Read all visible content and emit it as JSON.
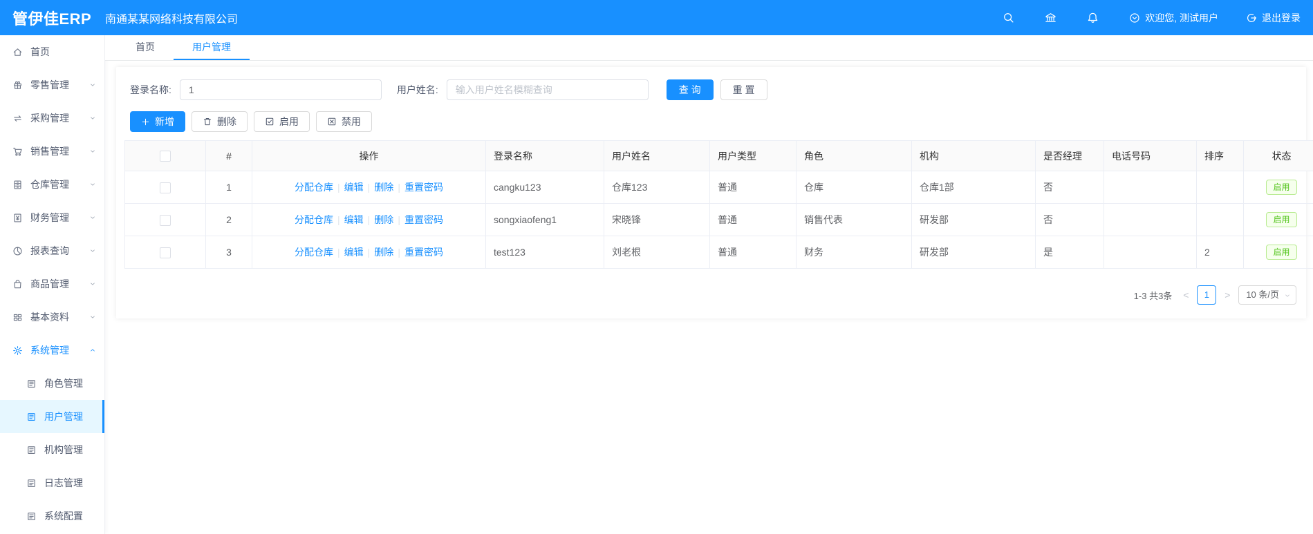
{
  "header": {
    "logo": "管伊佳ERP",
    "company": "南通某某网络科技有限公司",
    "welcome": "欢迎您, 测试用户",
    "logout": "退出登录"
  },
  "sidebar": {
    "items": [
      {
        "key": "home",
        "icon": "home",
        "label": "首页"
      },
      {
        "key": "retail",
        "icon": "retail",
        "label": "零售管理",
        "arrow": "down"
      },
      {
        "key": "purchase",
        "icon": "purchase",
        "label": "采购管理",
        "arrow": "down"
      },
      {
        "key": "sales",
        "icon": "sales",
        "label": "销售管理",
        "arrow": "down"
      },
      {
        "key": "warehouse",
        "icon": "warehouse",
        "label": "仓库管理",
        "arrow": "down"
      },
      {
        "key": "finance",
        "icon": "finance",
        "label": "财务管理",
        "arrow": "down"
      },
      {
        "key": "report",
        "icon": "report",
        "label": "报表查询",
        "arrow": "down"
      },
      {
        "key": "goods",
        "icon": "goods",
        "label": "商品管理",
        "arrow": "down"
      },
      {
        "key": "basic",
        "icon": "basic",
        "label": "基本资料",
        "arrow": "down"
      },
      {
        "key": "system",
        "icon": "system",
        "label": "系统管理",
        "arrow": "up",
        "active": true,
        "children": [
          {
            "key": "role",
            "label": "角色管理"
          },
          {
            "key": "user",
            "label": "用户管理",
            "active": true
          },
          {
            "key": "org",
            "label": "机构管理"
          },
          {
            "key": "log",
            "label": "日志管理"
          },
          {
            "key": "config",
            "label": "系统配置"
          }
        ]
      }
    ]
  },
  "tabs": [
    {
      "key": "home",
      "label": "首页",
      "active": false
    },
    {
      "key": "user-mgmt",
      "label": "用户管理",
      "active": true
    }
  ],
  "filters": {
    "login_name_label": "登录名称:",
    "login_name_value": "1",
    "user_name_label": "用户姓名:",
    "user_name_placeholder": "输入用户姓名模糊查询",
    "search_button": "查 询",
    "reset_button": "重 置"
  },
  "toolbar": {
    "add": "新增",
    "delete": "删除",
    "enable": "启用",
    "disable": "禁用"
  },
  "table": {
    "headers": [
      "#",
      "操作",
      "登录名称",
      "用户姓名",
      "用户类型",
      "角色",
      "机构",
      "是否经理",
      "电话号码",
      "排序",
      "状态"
    ],
    "action_links": [
      "分配仓库",
      "编辑",
      "删除",
      "重置密码"
    ],
    "rows": [
      {
        "index": "1",
        "login": "cangku123",
        "name": "仓库123",
        "type": "普通",
        "role": "仓库",
        "org": "仓库1部",
        "manager": "否",
        "phone": "",
        "sort": "",
        "status": "启用"
      },
      {
        "index": "2",
        "login": "songxiaofeng1",
        "name": "宋晓锋",
        "type": "普通",
        "role": "销售代表",
        "org": "研发部",
        "manager": "否",
        "phone": "",
        "sort": "",
        "status": "启用"
      },
      {
        "index": "3",
        "login": "test123",
        "name": "刘老根",
        "type": "普通",
        "role": "财务",
        "org": "研发部",
        "manager": "是",
        "phone": "",
        "sort": "2",
        "status": "启用"
      }
    ]
  },
  "pagination": {
    "total": "1-3 共3条",
    "current_page": "1",
    "page_size": "10 条/页"
  },
  "colors": {
    "primary": "#1890ff",
    "success": "#52c41a"
  }
}
